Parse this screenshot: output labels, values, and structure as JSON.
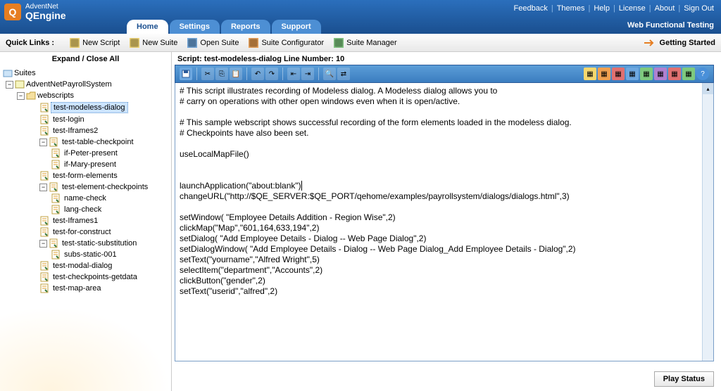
{
  "brand": {
    "name": "AdventNet",
    "product": "QEngine"
  },
  "topLinks": [
    "Feedback",
    "Themes",
    "Help",
    "License",
    "About",
    "Sign Out"
  ],
  "subtitle": "Web Functional Testing",
  "navTabs": {
    "active": "Home",
    "items": [
      "Home",
      "Settings",
      "Reports",
      "Support"
    ]
  },
  "toolbar": {
    "quickLinks": "Quick Links :",
    "items": [
      "New Script",
      "New Suite",
      "Open Suite",
      "Suite Configurator",
      "Suite Manager"
    ],
    "gettingStarted": "Getting Started"
  },
  "sidebar": {
    "expandCollapse": "Expand / Close All",
    "rootLabel": "Suites",
    "tree": {
      "project": "AdventNetPayrollSystem",
      "folder": "webscripts",
      "selected": "test-modeless-dialog",
      "items": [
        {
          "label": "test-modeless-dialog",
          "depth": 3,
          "selected": true
        },
        {
          "label": "test-login",
          "depth": 3
        },
        {
          "label": "test-Iframes2",
          "depth": 3
        },
        {
          "label": "test-table-checkpoint",
          "depth": 3,
          "expanded": true,
          "hasChildren": true
        },
        {
          "label": "if-Peter-present",
          "depth": 4
        },
        {
          "label": "if-Mary-present",
          "depth": 4
        },
        {
          "label": "test-form-elements",
          "depth": 3
        },
        {
          "label": "test-element-checkpoints",
          "depth": 3,
          "expanded": true,
          "hasChildren": true
        },
        {
          "label": "name-check",
          "depth": 4
        },
        {
          "label": "lang-check",
          "depth": 4
        },
        {
          "label": "test-Iframes1",
          "depth": 3
        },
        {
          "label": "test-for-construct",
          "depth": 3
        },
        {
          "label": "test-static-substitution",
          "depth": 3,
          "expanded": true,
          "hasChildren": true
        },
        {
          "label": "subs-static-001",
          "depth": 4
        },
        {
          "label": "test-modal-dialog",
          "depth": 3
        },
        {
          "label": "test-checkpoints-getdata",
          "depth": 3
        },
        {
          "label": "test-map-area",
          "depth": 3
        }
      ]
    }
  },
  "editor": {
    "titlePrefix": "Script: ",
    "scriptName": "test-modeless-dialog",
    "lineLabel": " Line Number: ",
    "lineNumber": "10",
    "lines": [
      "# This script illustrates recording of Modeless dialog. A Modeless dialog allows you to",
      "# carry on operations with other open windows even when it is open/active.",
      "",
      "# This sample webscript shows successful recording of the form elements loaded in the modeless dialog.",
      "# Checkpoints have also been set.",
      "",
      "useLocalMapFile()",
      "",
      "",
      "launchApplication(\"about:blank\")",
      "changeURL(\"http://$QE_SERVER:$QE_PORT/qehome/examples/payrollsystem/dialogs/dialogs.html\",3)",
      "",
      "setWindow( \"Employee Details Addition - Region Wise\",2)",
      "clickMap(\"Map\",\"601,164,633,194\",2)",
      "setDialog( \"Add Employee Details - Dialog -- Web Page Dialog\",2)",
      "setDialogWindow( \"Add Employee Details - Dialog -- Web Page Dialog_Add Employee Details - Dialog\",2)",
      "setText(\"yourname\",\"Alfred Wright\",5)",
      "selectItem(\"department\",\"Accounts\",2)",
      "clickButton(\"gender\",2)",
      "setText(\"userid\",\"alfred\",2)"
    ]
  },
  "playStatus": "Play Status"
}
